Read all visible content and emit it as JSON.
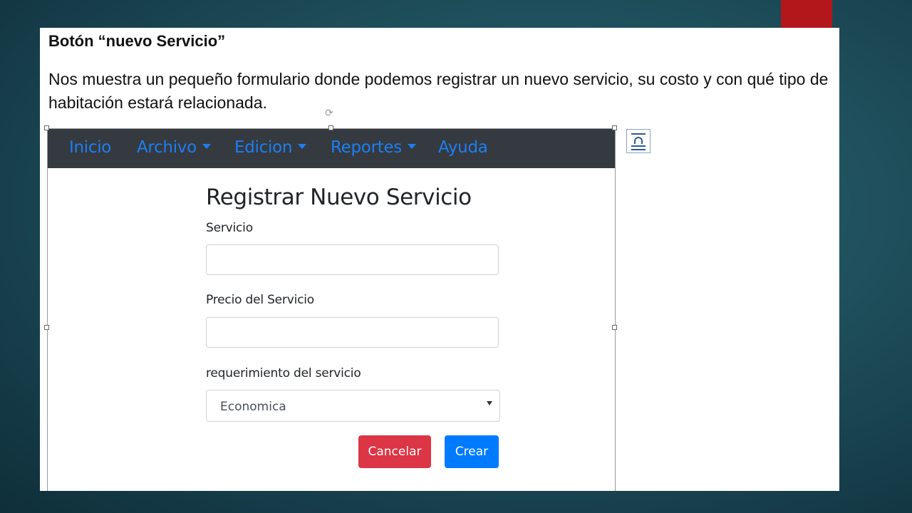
{
  "slide": {
    "heading": "Botón “nuevo Servicio”",
    "description": "Nos muestra un pequeño formulario donde podemos registrar un nuevo servicio, su costo y con qué tipo de habitación estará relacionada."
  },
  "navbar": {
    "items": [
      {
        "label": "Inicio",
        "dropdown": false
      },
      {
        "label": "Archivo",
        "dropdown": true
      },
      {
        "label": "Edicion",
        "dropdown": true
      },
      {
        "label": "Reportes",
        "dropdown": true
      },
      {
        "label": "Ayuda",
        "dropdown": false
      }
    ]
  },
  "form": {
    "title": "Registrar Nuevo Servicio",
    "servicio_label": "Servicio",
    "servicio_value": "",
    "precio_label": "Precio del Servicio",
    "precio_value": "",
    "requerimiento_label": "requerimiento del servicio",
    "requerimiento_selected": "Economica",
    "cancel_label": "Cancelar",
    "create_label": "Crear"
  },
  "colors": {
    "accent_red": "#b3161b",
    "navbar_bg": "#343a40",
    "nav_link": "#1e7ef0",
    "cancel_button": "#dc3545",
    "create_button": "#007bff"
  },
  "icons": {
    "rotate_handle": "rotate-icon",
    "layout_options": "layout-options-icon"
  }
}
